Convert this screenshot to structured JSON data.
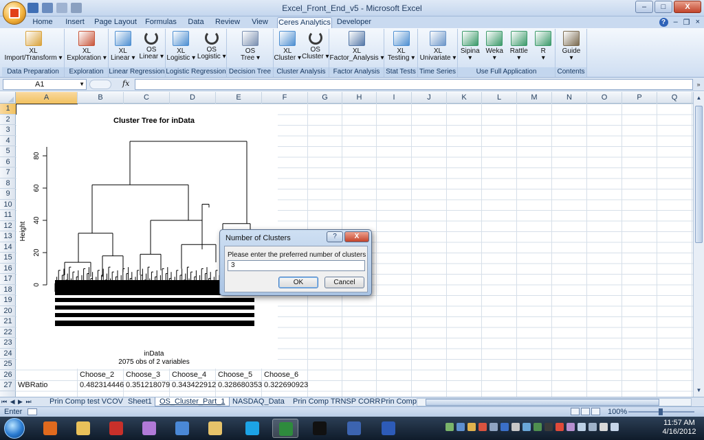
{
  "window": {
    "title": "Excel_Front_End_v5 - Microsoft Excel",
    "controls": {
      "minimize": "–",
      "maximize": "□",
      "close": "X"
    }
  },
  "ribbon_tabs": [
    {
      "label": "Home"
    },
    {
      "label": "Insert"
    },
    {
      "label": "Page Layout"
    },
    {
      "label": "Formulas"
    },
    {
      "label": "Data"
    },
    {
      "label": "Review"
    },
    {
      "label": "View"
    },
    {
      "label": "Ceres Analytics",
      "active": true
    },
    {
      "label": "Developer"
    }
  ],
  "help_controls": {
    "help": "?",
    "minimize": "–",
    "restore": "❐",
    "close": "×"
  },
  "ribbon_groups": [
    {
      "label": "Data Preparation",
      "buttons": [
        {
          "l1": "XL",
          "l2": "Import/Transform ▾",
          "icon": "import-transform-icon",
          "color": "#d9a23a"
        }
      ]
    },
    {
      "label": "Exploration",
      "buttons": [
        {
          "l1": "XL",
          "l2": "Exploration ▾",
          "icon": "exploration-icon",
          "color": "#c8553a"
        }
      ]
    },
    {
      "label": "Linear Regression",
      "buttons": [
        {
          "l1": "XL",
          "l2": "Linear ▾",
          "icon": "linear-chart-icon",
          "color": "#4e8fd1"
        },
        {
          "l1": "OS",
          "l2": "Linear ▾",
          "icon": "refresh-icon",
          "color": "#3a3a3a"
        }
      ]
    },
    {
      "label": "Logistic Regression",
      "buttons": [
        {
          "l1": "XL",
          "l2": "Logistic ▾",
          "icon": "logistic-chart-icon",
          "color": "#4e8fd1"
        },
        {
          "l1": "OS",
          "l2": "Logistic ▾",
          "icon": "refresh-icon",
          "color": "#3a3a3a"
        }
      ]
    },
    {
      "label": "Decision Tree",
      "buttons": [
        {
          "l1": "OS",
          "l2": "Tree ▾",
          "icon": "tree-icon",
          "color": "#7a8fb0"
        }
      ]
    },
    {
      "label": "Cluster Analysis",
      "buttons": [
        {
          "l1": "XL",
          "l2": "Cluster ▾",
          "icon": "cluster-chart-icon",
          "color": "#4e8fd1"
        },
        {
          "l1": "OS",
          "l2": "Cluster ▾",
          "icon": "refresh-icon",
          "color": "#3a3a3a"
        }
      ]
    },
    {
      "label": "Factor Analysis",
      "buttons": [
        {
          "l1": "XL",
          "l2": "Factor_Analysis ▾",
          "icon": "factor-analysis-icon",
          "color": "#5578a8"
        }
      ]
    },
    {
      "label": "Stat Tests",
      "buttons": [
        {
          "l1": "XL",
          "l2": "Testing ▾",
          "icon": "histogram-icon",
          "color": "#4e8fd1"
        }
      ]
    },
    {
      "label": "Time Series",
      "buttons": [
        {
          "l1": "XL",
          "l2": "Univariate ▾",
          "icon": "time-series-icon",
          "color": "#6c96c9"
        }
      ]
    },
    {
      "label": "Use Full Application",
      "buttons": [
        {
          "l1": "Sipina",
          "l2": "▾",
          "icon": "sipina-icon",
          "color": "#3c9a6a"
        },
        {
          "l1": "Weka",
          "l2": "▾",
          "icon": "weka-icon",
          "color": "#3c9a6a"
        },
        {
          "l1": "Rattle",
          "l2": "▾",
          "icon": "rattle-icon",
          "color": "#3c9a6a"
        },
        {
          "l1": "R",
          "l2": "▾",
          "icon": "r-icon",
          "color": "#3c9a6a"
        }
      ]
    },
    {
      "label": "Contents",
      "buttons": [
        {
          "l1": "Guide",
          "l2": "▾",
          "icon": "guide-icon",
          "color": "#7a6a50"
        }
      ]
    }
  ],
  "formula_bar": {
    "name_box": "A1",
    "fx": "fx",
    "formula": ""
  },
  "columns": [
    "A",
    "B",
    "C",
    "D",
    "E",
    "F",
    "G",
    "H",
    "I",
    "J",
    "K",
    "L",
    "M",
    "N",
    "O",
    "P",
    "Q"
  ],
  "rows": [
    "1",
    "2",
    "3",
    "4",
    "5",
    "6",
    "7",
    "8",
    "9",
    "10",
    "11",
    "12",
    "13",
    "14",
    "15",
    "16",
    "17",
    "18",
    "19",
    "20",
    "21",
    "22",
    "23",
    "24",
    "25",
    "26",
    "27"
  ],
  "chart": {
    "title": "Cluster Tree for inData",
    "ylabel": "Height",
    "yticks": [
      "0",
      "20",
      "40",
      "60",
      "80"
    ],
    "xlabel": "inData",
    "subtitle": "2075 obs of 2 variables"
  },
  "cells": {
    "row26": [
      "Choose_2",
      "Choose_3",
      "Choose_4",
      "Choose_5",
      "Choose_6"
    ],
    "row27": [
      "WBRatio",
      "0.482314446",
      "0.351218079",
      "0.343422912",
      "0.328680353",
      "0.322690923"
    ]
  },
  "sheet_tabs": [
    {
      "label": "Prin Comp test VCOV"
    },
    {
      "label": "Sheet1"
    },
    {
      "label": "OS_Cluster_Part_1",
      "active": true
    },
    {
      "label": "NASDAQ_Data"
    },
    {
      "label": "Prin Comp TRNSP CORR"
    },
    {
      "label": "Prin Comp"
    }
  ],
  "sheet_nav": "⏮ ◀ ▶ ⏭",
  "status": {
    "mode": "Enter",
    "zoom": "100%"
  },
  "dialog": {
    "title": "Number of Clusters",
    "help": "?",
    "close": "X",
    "prompt": "Please enter the preferred number of clusters",
    "value": "3",
    "ok": "OK",
    "cancel": "Cancel"
  },
  "taskbar": {
    "items": [
      {
        "icon": "firefox-icon",
        "color": "#e06a1e"
      },
      {
        "icon": "folder-icon",
        "color": "#e9c15a"
      },
      {
        "icon": "pdf-icon",
        "color": "#c8302a"
      },
      {
        "icon": "winamp-icon",
        "color": "#b07ad8"
      },
      {
        "icon": "itunes-icon",
        "color": "#4a88d6"
      },
      {
        "icon": "mail-icon",
        "color": "#e6c36a"
      },
      {
        "icon": "skype-icon",
        "color": "#1ca3e6"
      },
      {
        "icon": "excel-icon",
        "color": "#2e8b3d",
        "active": true
      },
      {
        "icon": "cmd-icon",
        "color": "#111111"
      },
      {
        "icon": "r-gui-icon",
        "color": "#3c64b0"
      },
      {
        "icon": "word-icon",
        "color": "#2d5bb8"
      }
    ],
    "time": "11:57 AM",
    "date": "4/16/2012"
  }
}
